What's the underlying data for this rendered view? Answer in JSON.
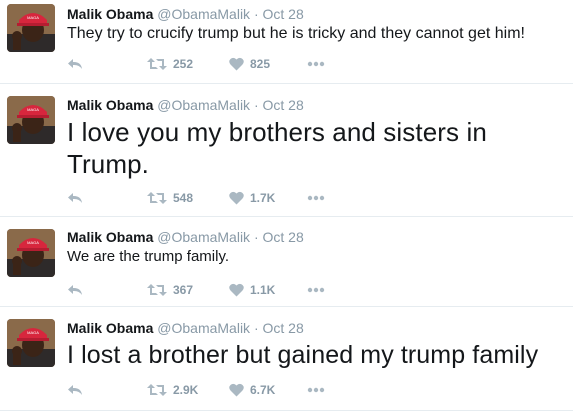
{
  "colors": {
    "icon": "#aab8c2",
    "muted": "#8899a6",
    "text": "#14171a",
    "divider": "#e6ecf0",
    "hat": "#d7263d"
  },
  "icons": {
    "reply": "reply-icon",
    "retweet": "retweet-icon",
    "like": "heart-icon",
    "more": "more-icon"
  },
  "tweets": [
    {
      "name": "Malik Obama",
      "handle": "@ObamaMalik",
      "sep": "·",
      "date": "Oct 28",
      "text": "They try to crucify trump but he is tricky and they cannot get him!",
      "retweets": "252",
      "likes": "825"
    },
    {
      "name": "Malik Obama",
      "handle": "@ObamaMalik",
      "sep": "·",
      "date": "Oct 28",
      "text": "I love you my brothers and sisters in Trump.",
      "retweets": "548",
      "likes": "1.7K"
    },
    {
      "name": "Malik Obama",
      "handle": "@ObamaMalik",
      "sep": "·",
      "date": "Oct 28",
      "text": "We are the trump family.",
      "retweets": "367",
      "likes": "1.1K"
    },
    {
      "name": "Malik Obama",
      "handle": "@ObamaMalik",
      "sep": "·",
      "date": "Oct 28",
      "text": "I lost a brother but gained my trump family",
      "retweets": "2.9K",
      "likes": "6.7K"
    }
  ]
}
